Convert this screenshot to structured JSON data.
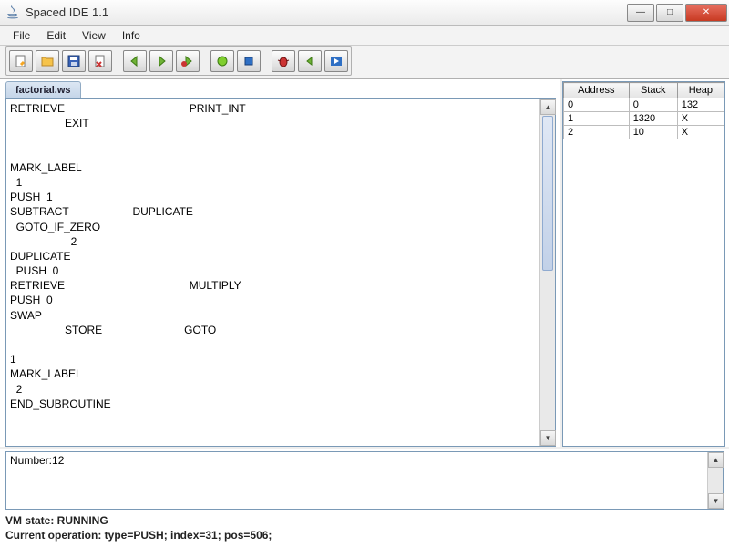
{
  "title": "Spaced IDE 1.1",
  "menu": [
    "File",
    "Edit",
    "View",
    "Info"
  ],
  "toolbar": [
    "new-file-icon",
    "open-folder-icon",
    "save-icon",
    "delete-file-icon",
    "sep",
    "arrow-left-icon",
    "arrow-right-icon",
    "debug-step-icon",
    "sep",
    "run-icon",
    "stop-icon",
    "sep",
    "debug-icon",
    "step-back-icon",
    "step-forward-icon"
  ],
  "tab": {
    "label": "factorial.ws"
  },
  "editor": {
    "content": "RETRIEVE                                         PRINT_INT\n                  EXIT\n\n\nMARK_LABEL\n  1\nPUSH  1\nSUBTRACT                     DUPLICATE\n  GOTO_IF_ZERO\n                    2\nDUPLICATE\n  PUSH  0\nRETRIEVE                                         MULTIPLY\nPUSH  0\nSWAP\n                  STORE                           GOTO\n\n1\nMARK_LABEL\n  2\nEND_SUBROUTINE"
  },
  "memory": {
    "headers": [
      "Address",
      "Stack",
      "Heap"
    ],
    "rows": [
      [
        "0",
        "0",
        "132"
      ],
      [
        "1",
        "1320",
        "X"
      ],
      [
        "2",
        "10",
        "X"
      ]
    ]
  },
  "console": {
    "output": "Number:12"
  },
  "status": {
    "state": "VM state: RUNNING",
    "op": "Current operation: type=PUSH; index=31; pos=506;"
  }
}
